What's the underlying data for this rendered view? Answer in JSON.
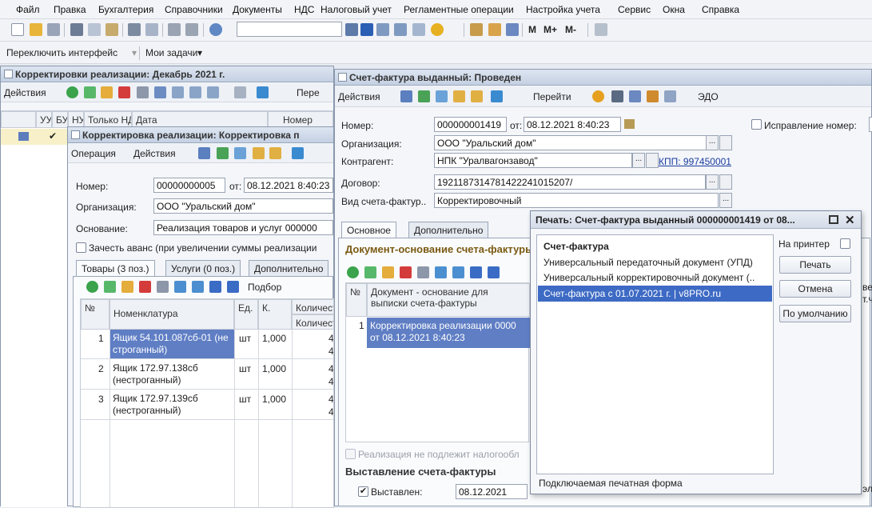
{
  "menu": [
    "Файл",
    "Правка",
    "Бухгалтерия",
    "Справочники",
    "Документы",
    "НДС",
    "Налоговый учет",
    "Регламентные операции",
    "Настройка учета",
    "Сервис",
    "Окна",
    "Справка"
  ],
  "toolbar": {
    "m": "M",
    "mplus": "M+",
    "mminus": "M-"
  },
  "toolbar2": {
    "switch": "Переключить интерфейс",
    "tasks": "Мои задачи"
  },
  "list_window": {
    "title": "Корректировки реализации: Декабрь 2021 г.",
    "actions": "Действия",
    "more": "Пере",
    "headers": [
      "УУ",
      "БУ",
      "НУ",
      "Только НДС",
      "Дата",
      "Номер"
    ]
  },
  "correction": {
    "title": "Корректировка реализации: Корректировка п",
    "operation": "Операция",
    "actions": "Действия",
    "number_label": "Номер:",
    "number_value": "00000000005",
    "from_label": "от:",
    "date_value": "08.12.2021  8:40:23",
    "org_label": "Организация:",
    "org_value": "ООО \"Уральский дом\"",
    "base_label": "Основание:",
    "base_value": "Реализация товаров и услуг 000000",
    "advance_label": "Зачесть аванс (при увеличении суммы реализации",
    "tabs": [
      "Товары (3 поз.)",
      "Услуги (0 поз.)",
      "Дополнительно"
    ],
    "pick": "Подбор",
    "headers": [
      "№",
      "Номенклатура",
      "Ед.",
      "К.",
      "Количест",
      "Количест"
    ],
    "rows": [
      {
        "n": "1",
        "name1": "Ящик 54.101.087сб-01 (не",
        "name2": "строганный)",
        "unit": "шт",
        "k": "1,000",
        "q": "4",
        "q2": "4"
      },
      {
        "n": "2",
        "name1": "Ящик 172.97.138сб",
        "name2": "(нестроганный)",
        "unit": "шт",
        "k": "1,000",
        "q": "4",
        "q2": "4"
      },
      {
        "n": "3",
        "name1": "Ящик 172.97.139сб",
        "name2": "(нестроганный)",
        "unit": "шт",
        "k": "1,000",
        "q": "4",
        "q2": "4"
      }
    ]
  },
  "invoice": {
    "title": "Счет-фактура выданный: Проведен",
    "actions": "Действия",
    "goto": "Перейти",
    "edo": "ЭДО",
    "number_label": "Номер:",
    "number_value": "000000001419",
    "from_label": "от:",
    "date_value": "08.12.2021  8:40:23",
    "fix_label": "Исправление номер:",
    "org_label": "Организация:",
    "org_value": "ООО \"Уральский дом\"",
    "contractor_label": "Контрагент:",
    "contractor_value": "НПК \"Уралвагонзавод\"",
    "kpp": "КПП: 997450001",
    "contract_label": "Договор:",
    "contract_value": "1921187314781422241015207/",
    "type_label": "Вид счета-фактур..",
    "type_value": "Корректировочный",
    "tabs": [
      "Основное",
      "Дополнительно"
    ],
    "section_base": "Документ-основание счета-фактуры",
    "grid_headers": [
      "№",
      "Документ - основание для выписки счета-фактуры"
    ],
    "grid_row_n": "1",
    "grid_row_text1": "Корректировка реализации 0000",
    "grid_row_text2": "от 08.12.2021 8:40:23",
    "not_taxed": "Реализация не подлежит налогообл",
    "section_issue": "Выставление счета-фактуры",
    "issued_label": "Выставлен:",
    "issued_date": "08.12.2021",
    "right_cut": "ве",
    "right_cut2": "т.ч",
    "right_cut3": "эл"
  },
  "print_dialog": {
    "title": "Печать: Счет-фактура выданный 000000001419 от 08...",
    "options": [
      "Счет-фактура",
      "Универсальный передаточный документ (УПД)",
      "Универсальный корректировочный документ (..",
      "Счет-фактура с 01.07.2021 г. | v8PRO.ru"
    ],
    "selected_index": 3,
    "to_printer": "На принтер",
    "print_btn": "Печать",
    "cancel_btn": "Отмена",
    "default_btn": "По умолчанию",
    "footer": "Подключаемая печатная форма"
  }
}
